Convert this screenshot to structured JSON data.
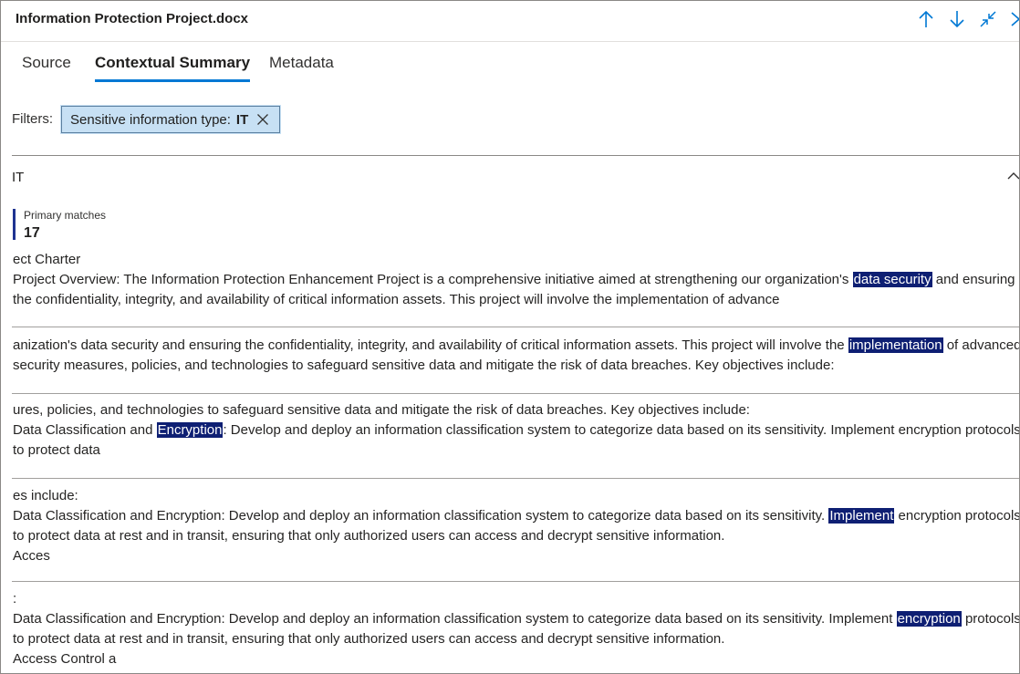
{
  "header": {
    "title": "Information Protection Project.docx",
    "buttons": {
      "previous_icon": "arrow-up-icon",
      "next_icon": "arrow-down-icon",
      "collapse_icon": "minimize-icon",
      "close_icon": "close-icon"
    }
  },
  "tabs": [
    {
      "label": "Source",
      "active": false
    },
    {
      "label": "Contextual Summary",
      "active": true
    },
    {
      "label": "Metadata",
      "active": false
    }
  ],
  "filters": {
    "label": "Filters:",
    "chip": {
      "prefix": "Sensitive information type:",
      "value": "IT"
    }
  },
  "section": {
    "title": "IT",
    "primary_matches_label": "Primary matches",
    "primary_matches_count": "17"
  },
  "snippets": [
    {
      "lines": [
        [
          {
            "t": "ect Charter"
          }
        ],
        [
          {
            "t": "Project Overview: The Information Protection Enhancement Project is a comprehensive initiative aimed at strengthening our organization's "
          },
          {
            "t": "data security",
            "h": true
          },
          {
            "t": " and ensuring"
          }
        ],
        [
          {
            "t": "the confidentiality, integrity, and availability of critical information assets. This project will involve the implementation of advance"
          }
        ]
      ]
    },
    {
      "lines": [
        [
          {
            "t": "anization's data security and ensuring the confidentiality, integrity, and availability of critical information assets. This project will involve the "
          },
          {
            "t": "implementation",
            "h": true
          },
          {
            "t": " of advanced"
          }
        ],
        [
          {
            "t": "security measures, policies, and technologies to safeguard sensitive data and mitigate the risk of data breaches. Key objectives include:"
          }
        ]
      ]
    },
    {
      "lines": [
        [
          {
            "t": "ures, policies, and technologies to safeguard sensitive data and mitigate the risk of data breaches. Key objectives include:"
          }
        ],
        [
          {
            "t": "Data Classification and "
          },
          {
            "t": "Encryption",
            "h": true
          },
          {
            "t": ": Develop and deploy an information classification system to categorize data based on its sensitivity. Implement encryption protocols"
          }
        ],
        [
          {
            "t": "to protect data"
          }
        ]
      ]
    },
    {
      "lines": [
        [
          {
            "t": "es include:"
          }
        ],
        [
          {
            "t": "Data Classification and Encryption: Develop and deploy an information classification system to categorize data based on its sensitivity. "
          },
          {
            "t": "Implement",
            "h": true
          },
          {
            "t": " encryption protocols"
          }
        ],
        [
          {
            "t": "to protect data at rest and in transit, ensuring that only authorized users can access and decrypt sensitive information."
          }
        ],
        [
          {
            "t": "Acces"
          }
        ]
      ]
    },
    {
      "lines": [
        [
          {
            "t": ":"
          }
        ],
        [
          {
            "t": "Data Classification and Encryption: Develop and deploy an information classification system to categorize data based on its sensitivity. Implement "
          },
          {
            "t": "encryption",
            "h": true
          },
          {
            "t": " protocols"
          }
        ],
        [
          {
            "t": "to protect data at rest and in transit, ensuring that only authorized users can access and decrypt sensitive information."
          }
        ],
        [
          {
            "t": "Access Control a"
          }
        ]
      ]
    }
  ],
  "colors": {
    "accent": "#0078d4",
    "highlight_bg": "#0e1f73",
    "chip_bg": "#c7e0f4",
    "match_bar": "#1f3391"
  }
}
